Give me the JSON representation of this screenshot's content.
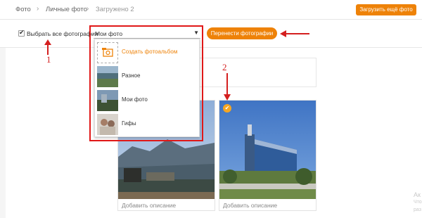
{
  "breadcrumbs": {
    "photo": "Фото",
    "personal": "Личные фото",
    "uploaded": "Загружено 2"
  },
  "header": {
    "upload_more": "Загрузить ещё фото"
  },
  "toolbar": {
    "select_all": "Выбрать все фотографии",
    "album_value": "Мои фото",
    "move_button": "Перенести фотографии"
  },
  "dropdown": {
    "items": [
      {
        "label": "Создать фотоальбом",
        "icon": "add-album-icon"
      },
      {
        "label": "Разное"
      },
      {
        "label": "Мои фото"
      },
      {
        "label": "Гифы"
      }
    ]
  },
  "cards": [
    {
      "description": "Добавить описание"
    },
    {
      "description": "Добавить описание"
    }
  ],
  "annotations": {
    "one": "1",
    "two": "2"
  },
  "watermark": {
    "line1": "Ак",
    "line2": "Что",
    "line3": "раз"
  },
  "colors": {
    "accent": "#ee8208",
    "annotation_red": "#e01818"
  }
}
